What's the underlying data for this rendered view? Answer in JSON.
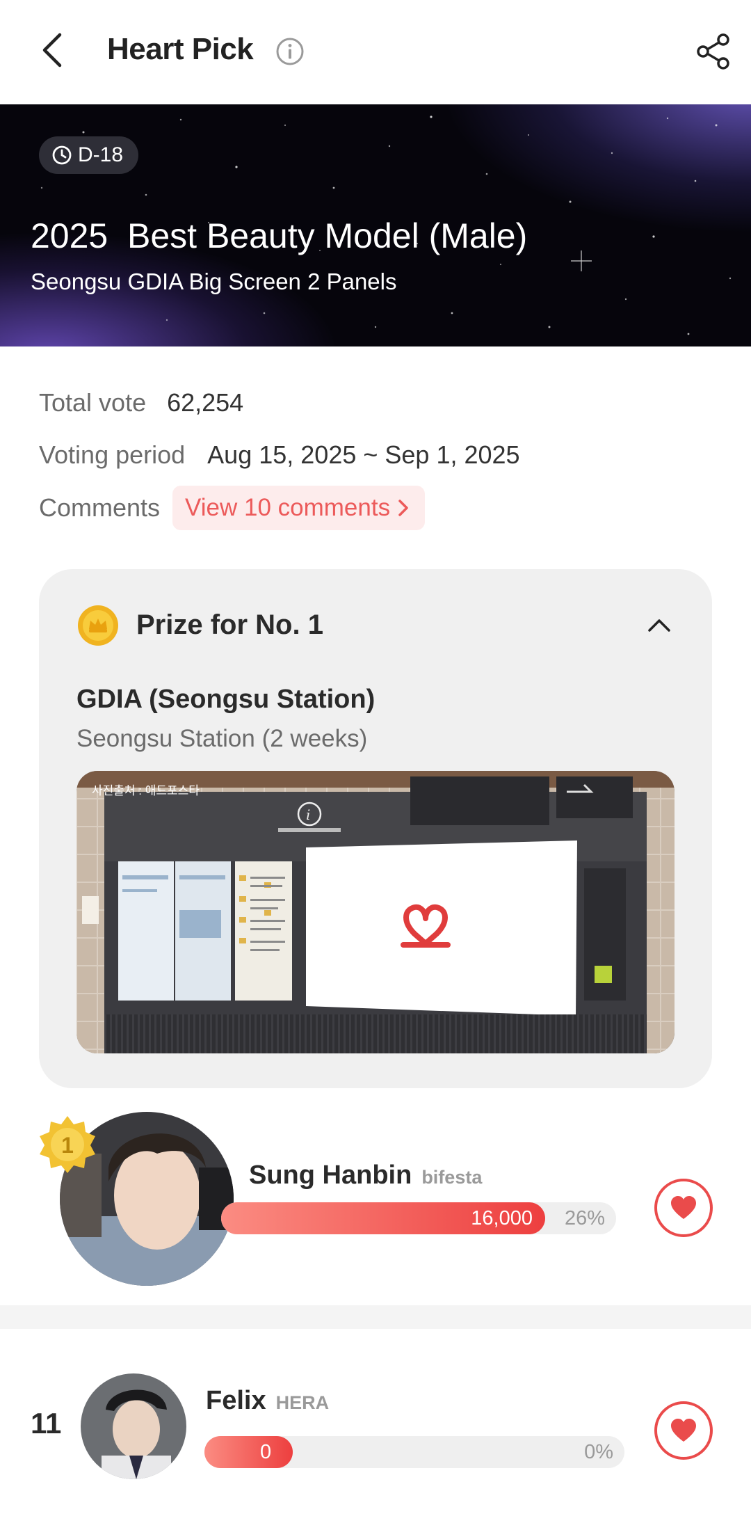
{
  "header": {
    "title": "Heart Pick",
    "back_icon": "chevron-left-icon",
    "info_icon": "info-circle-icon",
    "share_icon": "share-icon"
  },
  "banner": {
    "dday": "D-18",
    "title": "2025  Best Beauty Model (Male)",
    "subtitle": "Seongsu GDIA Big Screen 2 Panels"
  },
  "info": {
    "total_vote_label": "Total vote",
    "total_vote_value": "62,254",
    "period_label": "Voting period",
    "period_value": "Aug 15, 2025 ~ Sep 1, 2025",
    "comments_label": "Comments",
    "comments_button": "View 10 comments"
  },
  "prize": {
    "title": "Prize for No. 1",
    "name": "GDIA (Seongsu Station)",
    "description": "Seongsu Station (2 weeks)",
    "photo_credit": "사진출처 : 애드포스타"
  },
  "candidates": [
    {
      "rank": "1",
      "name": "Sung Hanbin",
      "agency": "bifesta",
      "votes": "16,000",
      "percent": "26%",
      "fill": 0.82
    },
    {
      "rank": "11",
      "name": "Felix",
      "agency": "HERA",
      "votes": "0",
      "percent": "0%",
      "fill": 0.21
    }
  ],
  "colors": {
    "accent": "#ea4b4b",
    "bar_start": "#fb8c82",
    "bar_end": "#ed3f3f",
    "comments_bg": "#fdecec"
  }
}
